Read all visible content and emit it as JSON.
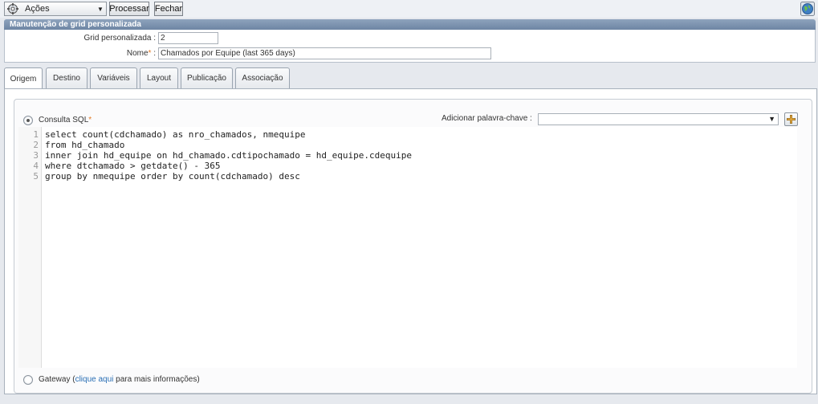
{
  "toolbar": {
    "actions_select": "Ações",
    "process_button": "Processar",
    "close_button": "Fechar"
  },
  "panel": {
    "title": "Manutenção de grid personalizada",
    "grid_label": "Grid personalizada :",
    "grid_value": "2",
    "name_label": "Nome",
    "name_required_mark": "*",
    "name_colon": " :",
    "name_value": "Chamados por Equipe (last 365 days)"
  },
  "tabs": [
    "Origem",
    "Destino",
    "Variáveis",
    "Layout",
    "Publicação",
    "Associação"
  ],
  "active_tab": "Origem",
  "origin": {
    "sql_label": "Consulta SQL",
    "sql_required_mark": "*",
    "keyword_label": "Adicionar palavra-chave :",
    "keyword_value": "",
    "gateway_label": "Gateway",
    "gateway_paren_open": " (",
    "gateway_link": "clique aqui",
    "gateway_suffix": " para mais informações)"
  },
  "code_lines": [
    {
      "n": "1",
      "text": "select count(cdchamado) as nro_chamados, nmequipe"
    },
    {
      "n": "2",
      "text": "from hd_chamado"
    },
    {
      "n": "3",
      "text": "inner join hd_equipe on hd_chamado.cdtipochamado = hd_equipe.cdequipe"
    },
    {
      "n": "4",
      "text": "where dtchamado > getdate() - 365"
    },
    {
      "n": "5",
      "text": "group by nmequipe order by count(cdchamado) desc"
    }
  ],
  "colors": {
    "header_bar": "#7a8fab",
    "link": "#2a6fb5",
    "required": "#e37b26"
  }
}
